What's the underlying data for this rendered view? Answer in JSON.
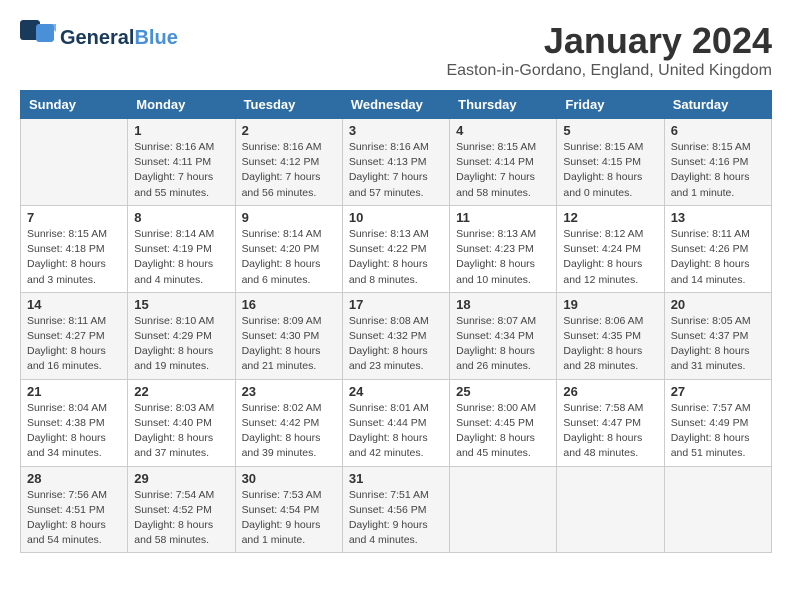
{
  "logo": {
    "line1": "General",
    "line2": "Blue",
    "icon": "▶"
  },
  "title": "January 2024",
  "subtitle": "Easton-in-Gordano, England, United Kingdom",
  "headers": [
    "Sunday",
    "Monday",
    "Tuesday",
    "Wednesday",
    "Thursday",
    "Friday",
    "Saturday"
  ],
  "weeks": [
    [
      {
        "num": "",
        "info": ""
      },
      {
        "num": "1",
        "info": "Sunrise: 8:16 AM\nSunset: 4:11 PM\nDaylight: 7 hours\nand 55 minutes."
      },
      {
        "num": "2",
        "info": "Sunrise: 8:16 AM\nSunset: 4:12 PM\nDaylight: 7 hours\nand 56 minutes."
      },
      {
        "num": "3",
        "info": "Sunrise: 8:16 AM\nSunset: 4:13 PM\nDaylight: 7 hours\nand 57 minutes."
      },
      {
        "num": "4",
        "info": "Sunrise: 8:15 AM\nSunset: 4:14 PM\nDaylight: 7 hours\nand 58 minutes."
      },
      {
        "num": "5",
        "info": "Sunrise: 8:15 AM\nSunset: 4:15 PM\nDaylight: 8 hours\nand 0 minutes."
      },
      {
        "num": "6",
        "info": "Sunrise: 8:15 AM\nSunset: 4:16 PM\nDaylight: 8 hours\nand 1 minute."
      }
    ],
    [
      {
        "num": "7",
        "info": "Sunrise: 8:15 AM\nSunset: 4:18 PM\nDaylight: 8 hours\nand 3 minutes."
      },
      {
        "num": "8",
        "info": "Sunrise: 8:14 AM\nSunset: 4:19 PM\nDaylight: 8 hours\nand 4 minutes."
      },
      {
        "num": "9",
        "info": "Sunrise: 8:14 AM\nSunset: 4:20 PM\nDaylight: 8 hours\nand 6 minutes."
      },
      {
        "num": "10",
        "info": "Sunrise: 8:13 AM\nSunset: 4:22 PM\nDaylight: 8 hours\nand 8 minutes."
      },
      {
        "num": "11",
        "info": "Sunrise: 8:13 AM\nSunset: 4:23 PM\nDaylight: 8 hours\nand 10 minutes."
      },
      {
        "num": "12",
        "info": "Sunrise: 8:12 AM\nSunset: 4:24 PM\nDaylight: 8 hours\nand 12 minutes."
      },
      {
        "num": "13",
        "info": "Sunrise: 8:11 AM\nSunset: 4:26 PM\nDaylight: 8 hours\nand 14 minutes."
      }
    ],
    [
      {
        "num": "14",
        "info": "Sunrise: 8:11 AM\nSunset: 4:27 PM\nDaylight: 8 hours\nand 16 minutes."
      },
      {
        "num": "15",
        "info": "Sunrise: 8:10 AM\nSunset: 4:29 PM\nDaylight: 8 hours\nand 19 minutes."
      },
      {
        "num": "16",
        "info": "Sunrise: 8:09 AM\nSunset: 4:30 PM\nDaylight: 8 hours\nand 21 minutes."
      },
      {
        "num": "17",
        "info": "Sunrise: 8:08 AM\nSunset: 4:32 PM\nDaylight: 8 hours\nand 23 minutes."
      },
      {
        "num": "18",
        "info": "Sunrise: 8:07 AM\nSunset: 4:34 PM\nDaylight: 8 hours\nand 26 minutes."
      },
      {
        "num": "19",
        "info": "Sunrise: 8:06 AM\nSunset: 4:35 PM\nDaylight: 8 hours\nand 28 minutes."
      },
      {
        "num": "20",
        "info": "Sunrise: 8:05 AM\nSunset: 4:37 PM\nDaylight: 8 hours\nand 31 minutes."
      }
    ],
    [
      {
        "num": "21",
        "info": "Sunrise: 8:04 AM\nSunset: 4:38 PM\nDaylight: 8 hours\nand 34 minutes."
      },
      {
        "num": "22",
        "info": "Sunrise: 8:03 AM\nSunset: 4:40 PM\nDaylight: 8 hours\nand 37 minutes."
      },
      {
        "num": "23",
        "info": "Sunrise: 8:02 AM\nSunset: 4:42 PM\nDaylight: 8 hours\nand 39 minutes."
      },
      {
        "num": "24",
        "info": "Sunrise: 8:01 AM\nSunset: 4:44 PM\nDaylight: 8 hours\nand 42 minutes."
      },
      {
        "num": "25",
        "info": "Sunrise: 8:00 AM\nSunset: 4:45 PM\nDaylight: 8 hours\nand 45 minutes."
      },
      {
        "num": "26",
        "info": "Sunrise: 7:58 AM\nSunset: 4:47 PM\nDaylight: 8 hours\nand 48 minutes."
      },
      {
        "num": "27",
        "info": "Sunrise: 7:57 AM\nSunset: 4:49 PM\nDaylight: 8 hours\nand 51 minutes."
      }
    ],
    [
      {
        "num": "28",
        "info": "Sunrise: 7:56 AM\nSunset: 4:51 PM\nDaylight: 8 hours\nand 54 minutes."
      },
      {
        "num": "29",
        "info": "Sunrise: 7:54 AM\nSunset: 4:52 PM\nDaylight: 8 hours\nand 58 minutes."
      },
      {
        "num": "30",
        "info": "Sunrise: 7:53 AM\nSunset: 4:54 PM\nDaylight: 9 hours\nand 1 minute."
      },
      {
        "num": "31",
        "info": "Sunrise: 7:51 AM\nSunset: 4:56 PM\nDaylight: 9 hours\nand 4 minutes."
      },
      {
        "num": "",
        "info": ""
      },
      {
        "num": "",
        "info": ""
      },
      {
        "num": "",
        "info": ""
      }
    ]
  ]
}
